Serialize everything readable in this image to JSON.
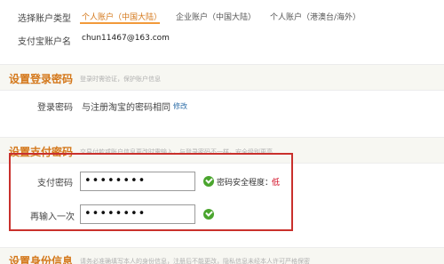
{
  "account_type": {
    "label": "选择账户类型",
    "tabs": [
      {
        "label": "个人账户（中国大陆）",
        "active": true
      },
      {
        "label": "企业账户（中国大陆）",
        "active": false
      },
      {
        "label": "个人账户（港澳台/海外）",
        "active": false
      }
    ]
  },
  "account_name": {
    "label": "支付宝账户名",
    "value": "chun11467@163.com"
  },
  "login_password_section": {
    "title": "设置登录密码",
    "description": "登录时需验证，保护账户信息"
  },
  "login_password": {
    "label": "登录密码",
    "value": "与注册淘宝的密码相同",
    "edit_link": "修改"
  },
  "payment_password_section": {
    "title": "设置支付密码",
    "description": "交易付款或账户信息更改时需输入，与登录密码不一样，安全级别更高"
  },
  "payment_password": {
    "label": "支付密码",
    "value": "••••••••",
    "strength_label": "密码安全程度：",
    "strength_value": "低"
  },
  "confirm_password": {
    "label": "再输入一次",
    "value": "••••••••"
  },
  "identity_section": {
    "title": "设置身份信息",
    "description": "请务必准确填写本人的身份信息，注册后不能更改，隐私信息未经本人许可严格保密"
  },
  "colors": {
    "accent": "#d4781b",
    "highlight_box": "#c9302c",
    "success": "#4aa52e",
    "weak": "#d0021b",
    "link": "#2e6ea8"
  }
}
